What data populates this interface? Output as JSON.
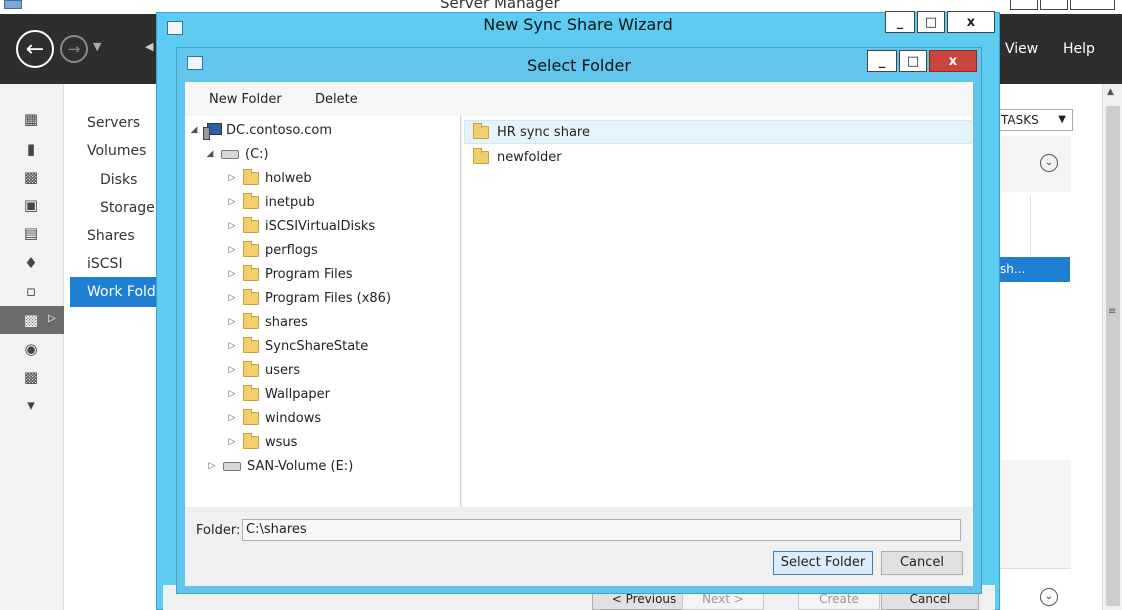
{
  "server_manager": {
    "title": "Server Manager",
    "menu": {
      "view": "View",
      "help": "Help"
    },
    "nav_items": [
      "Servers",
      "Volumes",
      "Disks",
      "Storage",
      "Shares",
      "iSCSI",
      "Work Fold"
    ],
    "tasks_label": "TASKS",
    "selected_row_text": "sh..."
  },
  "wizard": {
    "title": "New Sync Share Wizard",
    "buttons": {
      "previous": "< Previous",
      "next": "Next >",
      "create": "Create",
      "cancel": "Cancel"
    }
  },
  "dialog": {
    "title": "Select Folder",
    "toolbar": {
      "new_folder": "New Folder",
      "delete": "Delete"
    },
    "tree": {
      "computer": "DC.contoso.com",
      "drive_c": "(C:)",
      "folders": [
        "holweb",
        "inetpub",
        "iSCSIVirtualDisks",
        "perflogs",
        "Program Files",
        "Program Files (x86)",
        "shares",
        "SyncShareState",
        "users",
        "Wallpaper",
        "windows",
        "wsus"
      ],
      "drive_e": "SAN-Volume (E:)"
    },
    "list": [
      "HR sync share",
      "newfolder"
    ],
    "folder_label": "Folder:",
    "folder_value": "C:\\shares",
    "buttons": {
      "select": "Select Folder",
      "cancel": "Cancel"
    }
  },
  "window_controls": {
    "minimize": "_",
    "maximize": "□",
    "close": "x"
  },
  "colors": {
    "dialog_frame": "#62c5ec",
    "toolbar_dark": "#2e2e2e",
    "selection_blue": "#1e7fd3",
    "close_red": "#c9443c"
  }
}
